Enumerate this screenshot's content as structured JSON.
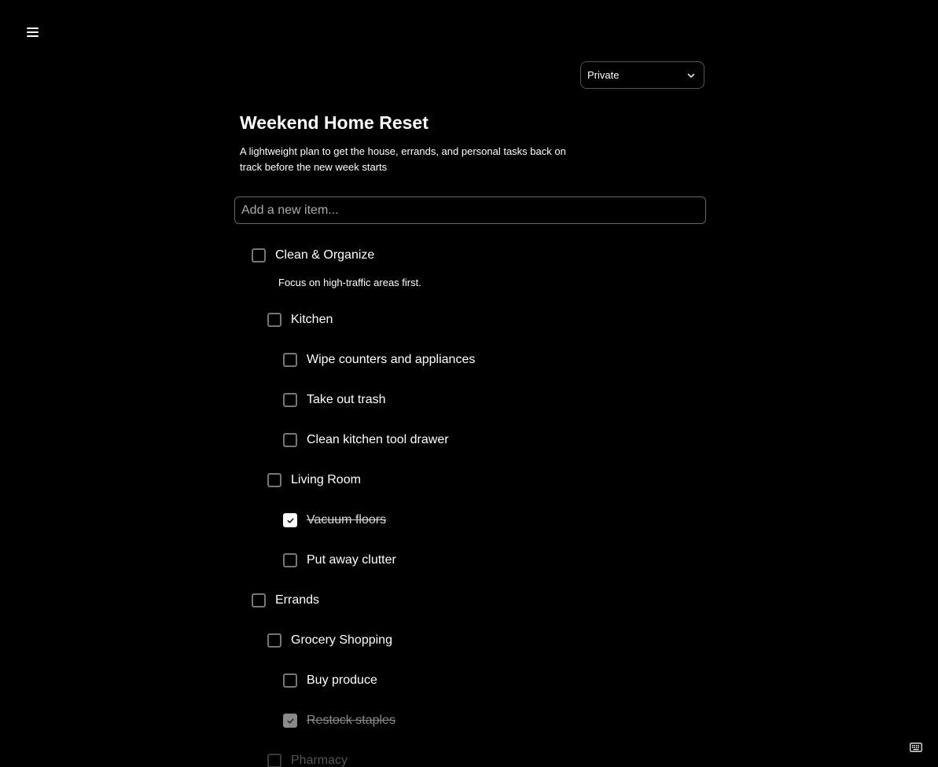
{
  "list": {
    "title": "Weekend Home Reset",
    "description": "A lightweight plan to get the house, errands, and personal tasks back on track before the new week starts",
    "visibility": "Private",
    "add_placeholder": "Add a new item..."
  },
  "items": [
    {
      "label": "Clean & Organize",
      "checked": false,
      "note": "Focus on high-traffic areas first."
    },
    {
      "label": "Kitchen",
      "checked": false
    },
    {
      "label": "Wipe counters and appliances",
      "checked": false
    },
    {
      "label": "Take out trash",
      "checked": false
    },
    {
      "label": "Clean kitchen tool drawer",
      "checked": false
    },
    {
      "label": "Living Room",
      "checked": false
    },
    {
      "label": "Vacuum floors",
      "checked": true
    },
    {
      "label": "Put away clutter",
      "checked": false
    },
    {
      "label": "Errands",
      "checked": false
    },
    {
      "label": "Grocery Shopping",
      "checked": false
    },
    {
      "label": "Buy produce",
      "checked": false
    },
    {
      "label": "Restock staples",
      "checked": true
    },
    {
      "label": "Pharmacy",
      "checked": false
    }
  ],
  "icons": {
    "menu": "hamburger-icon",
    "dropdown": "chevron-down-icon",
    "check": "check-icon",
    "keyboard": "keyboard-icon"
  }
}
